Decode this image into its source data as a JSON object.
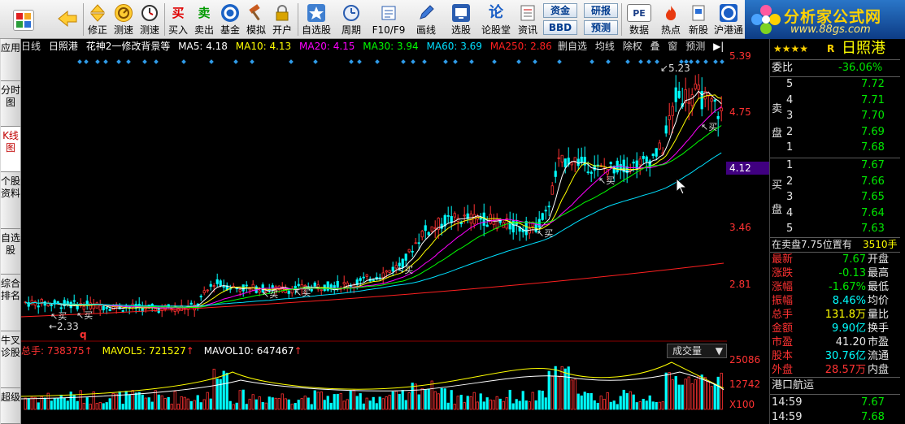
{
  "toolbar": {
    "buttons": [
      {
        "label": "",
        "icon": "app-grid-icon"
      },
      {
        "label": "",
        "icon": "back-arrow-icon"
      },
      {
        "label": "修正",
        "icon": "up-down-arrow-icon"
      },
      {
        "label": "测速",
        "icon": "speed-icon"
      },
      {
        "label": "测速",
        "icon": "clock-icon"
      },
      {
        "label": "买入",
        "icon_text": "买"
      },
      {
        "label": "卖出",
        "icon_text": "卖"
      },
      {
        "label": "基金",
        "icon": "fund-icon"
      },
      {
        "label": "模拟",
        "icon": "hammer-icon"
      },
      {
        "label": "开户",
        "icon": "lock-icon"
      },
      {
        "label": "自选股",
        "icon": "star-folder-icon"
      },
      {
        "label": "周期",
        "icon": "clock-period-icon"
      },
      {
        "label": "F10/F9",
        "icon": "f10-icon"
      },
      {
        "label": "画线",
        "icon": "pencil-icon"
      },
      {
        "label": "选股",
        "icon": "stock-select-icon"
      },
      {
        "label": "论股堂",
        "icon_text": "论"
      },
      {
        "label": "资讯",
        "icon": "news-icon"
      },
      {
        "label": "数据",
        "icon": "pe-icon"
      },
      {
        "label": "热点",
        "icon": "hot-icon"
      },
      {
        "label": "新股",
        "icon": "new-stock-icon"
      },
      {
        "label": "沪港通",
        "icon": "hk-icon"
      }
    ],
    "mini_buttons": {
      "zijin": "资金",
      "bbd": "BBD",
      "yanbao": "研报",
      "yuce": "预测",
      "pe": "PE"
    }
  },
  "logo": {
    "title": "分析家公式网",
    "url": "www.88gs.com"
  },
  "side_tabs": [
    "应用",
    "分时图",
    "K线图",
    "个股资料",
    "自选股",
    "综合排名",
    "牛叉诊股",
    "超级"
  ],
  "chart_header": {
    "period": "日线",
    "name": "日照港",
    "formula": "花神2一修改背景等",
    "ma5": "MA5: 4.18",
    "ma10": "MA10: 4.13",
    "ma20": "MA20: 4.15",
    "ma30": "MA30: 3.94",
    "ma60": "MA60: 3.69",
    "ma250": "MA250: 2.86"
  },
  "chart_tools": [
    "删自选",
    "均线",
    "除权",
    "叠",
    "窗",
    "预测"
  ],
  "price_axis": [
    "5.39",
    "4.75",
    "3.46",
    "2.81"
  ],
  "current_price_tag": "4.12",
  "annotations": {
    "high": "5.23",
    "low": "2.33",
    "buy": "买",
    "q": "q"
  },
  "volume_header": {
    "total": "总手: 738375",
    "mavol5": "MAVOL5: 721527",
    "mavol10": "MAVOL10: 647467",
    "selector": "成交量"
  },
  "volume_axis": [
    "25086",
    "12742",
    "X100"
  ],
  "quote": {
    "stars": "★★★★",
    "code_mark": "R",
    "stock_name": "日照港",
    "weibi_label": "委比",
    "weibi": "-36.06%",
    "sell_label": "卖盘",
    "buy_label": "买盘",
    "sells": [
      {
        "lvl": "5",
        "price": "7.72"
      },
      {
        "lvl": "4",
        "price": "7.71"
      },
      {
        "lvl": "3",
        "price": "7.70"
      },
      {
        "lvl": "2",
        "price": "7.69"
      },
      {
        "lvl": "1",
        "price": "7.68"
      }
    ],
    "buys": [
      {
        "lvl": "1",
        "price": "7.67"
      },
      {
        "lvl": "2",
        "price": "7.66"
      },
      {
        "lvl": "3",
        "price": "7.65"
      },
      {
        "lvl": "4",
        "price": "7.64"
      },
      {
        "lvl": "5",
        "price": "7.63"
      }
    ],
    "position_note": "在卖盘7.75位置有",
    "position_qty": "3510手",
    "stats": [
      {
        "label": "最新",
        "value": "7.67",
        "cls": "grn",
        "label2": "开盘"
      },
      {
        "label": "涨跌",
        "value": "-0.13",
        "cls": "grn",
        "label2": "最高"
      },
      {
        "label": "涨幅",
        "value": "-1.67%",
        "cls": "grn",
        "label2": "最低"
      },
      {
        "label": "振幅",
        "value": "8.46%",
        "cls": "cyn",
        "label2": "均价"
      },
      {
        "label": "总手",
        "value": "131.8万",
        "cls": "yel",
        "label2": "量比"
      },
      {
        "label": "金额",
        "value": "9.90亿",
        "cls": "cyn",
        "label2": "换手"
      },
      {
        "label": "市盈",
        "value": "41.20",
        "cls": "wht",
        "label2": "市盈"
      },
      {
        "label": "股本",
        "value": "30.76亿",
        "cls": "cyn",
        "label2": "流通"
      },
      {
        "label": "外盘",
        "value": "28.57万",
        "cls": "red",
        "label2": "内盘"
      }
    ],
    "sector": "港口航运",
    "ticks": [
      {
        "time": "14:59",
        "price": "7.67"
      },
      {
        "time": "14:59",
        "price": "7.68"
      }
    ]
  },
  "colors": {
    "up": "#ff3232",
    "down": "#00ffff",
    "ma5": "#ffffff",
    "ma10": "#ffff00",
    "ma20": "#ff00ff",
    "ma30": "#00ff00",
    "ma60": "#00e0ff",
    "ma250": "#ff2020"
  }
}
